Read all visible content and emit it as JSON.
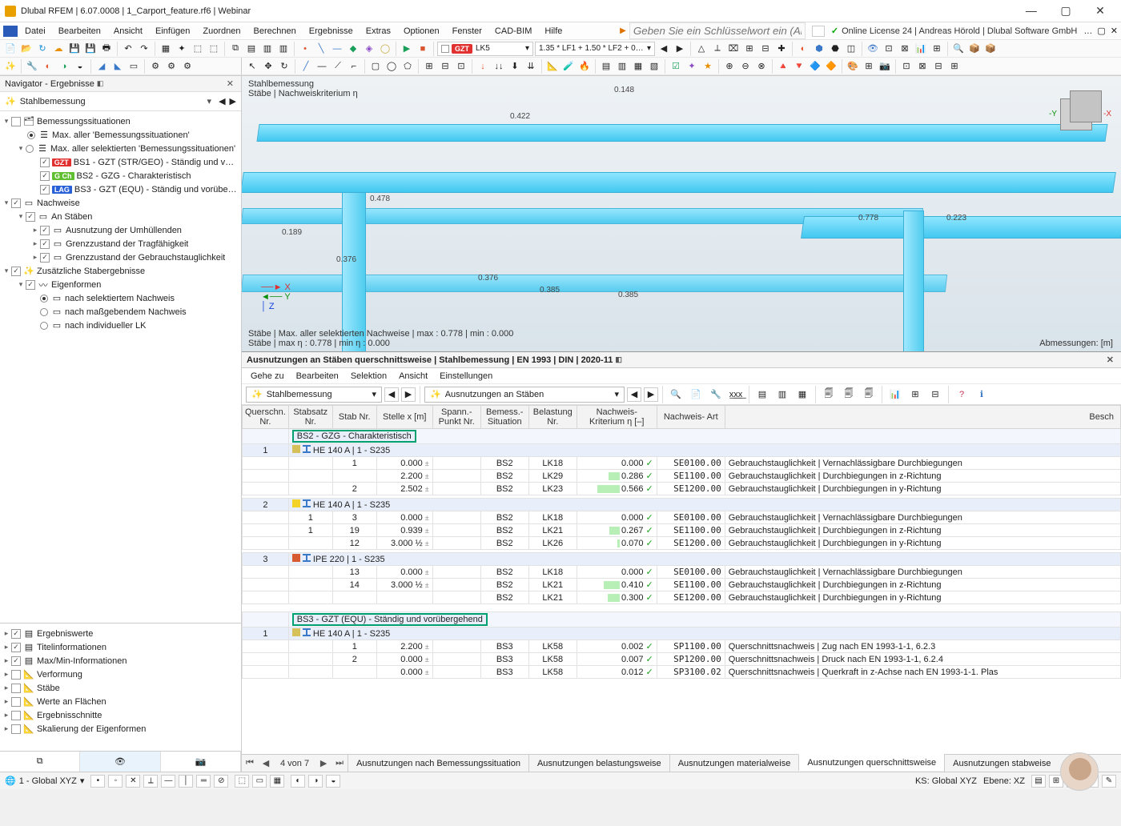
{
  "title": "Dlubal RFEM | 6.07.0008 | 1_Carport_feature.rf6 | Webinar",
  "menu": [
    "Datei",
    "Bearbeiten",
    "Ansicht",
    "Einfügen",
    "Zuordnen",
    "Berechnen",
    "Ergebnisse",
    "Extras",
    "Optionen",
    "Fenster",
    "CAD-BIM",
    "Hilfe"
  ],
  "searchPlaceholder": "Geben Sie ein Schlüsselwort ein (Alt…",
  "license": "Online License 24 | Andreas Hörold | Dlubal Software GmbH",
  "lcDrop": {
    "badge": "GZT",
    "lk": "LK5",
    "combo": "1.35 * LF1 + 1.50 * LF2 + 0…"
  },
  "navigator": {
    "title": "Navigator - Ergebnisse",
    "selector": "Stahlbemessung",
    "tree": {
      "bs": {
        "label": "Bemessungssituationen",
        "maxAll": "Max. aller 'Bemessungssituationen'",
        "maxSel": "Max. aller selektierten 'Bemessungssituationen'",
        "bs1": "BS1 - GZT (STR/GEO) - Ständig und vor…",
        "bs2": "BS2 - GZG - Charakteristisch",
        "bs3": "BS3 - GZT (EQU) - Ständig und vorüber…"
      },
      "nachweise": {
        "label": "Nachweise",
        "anStaeben": "An Stäben",
        "umh": "Ausnutzung der Umhüllenden",
        "trag": "Grenzzustand der Tragfähigkeit",
        "gebrauch": "Grenzzustand der Gebrauchstauglichkeit"
      },
      "zusatz": {
        "label": "Zusätzliche Stabergebnisse",
        "eig": "Eigenformen",
        "r1": "nach selektiertem Nachweis",
        "r2": "nach maßgebendem Nachweis",
        "r3": "nach individueller LK"
      }
    },
    "bottomNodes": [
      "Ergebniswerte",
      "Titelinformationen",
      "Max/Min-Informationen",
      "Verformung",
      "Stäbe",
      "Werte an Flächen",
      "Ergebnisschnitte",
      "Skalierung der Eigenformen"
    ]
  },
  "viewport": {
    "line1": "Stahlbemessung",
    "line2": "Stäbe | Nachweiskriterium η",
    "statsLine": "Stäbe | Max. aller selektierten Nachweise | max  : 0.778 | min  : 0.000",
    "etaLine": "Stäbe | max η : 0.778 | min η : 0.000",
    "dimLabel": "Abmessungen: [m]",
    "nums": {
      "a": "0.148",
      "b": "0.422",
      "c": "0.478",
      "d": "0.189",
      "e": "0.376",
      "f": "0.376",
      "g": "0.385",
      "h": "0.385",
      "i": "0.778",
      "j": "0.223"
    }
  },
  "results": {
    "title": "Ausnutzungen an Stäben querschnittsweise | Stahlbemessung | EN 1993 | DIN | 2020-11",
    "menus": [
      "Gehe zu",
      "Bearbeiten",
      "Selektion",
      "Ansicht",
      "Einstellungen"
    ],
    "leftSelector": "Stahlbemessung",
    "rightSelector": "Ausnutzungen an Stäben",
    "headers": {
      "q": "Querschn.\nNr.",
      "ss": "Stabsatz\nNr.",
      "st": "Stab\nNr.",
      "x": "Stelle\nx [m]",
      "sp": "Spann.-\nPunkt Nr.",
      "bs": "Bemess.-\nSituation",
      "lk": "Belastung\nNr.",
      "ratio": "Nachweis-\nKriterium η [–]",
      "art": "Nachweis-\nArt",
      "beschr": "Besch"
    },
    "group1": "BS2 - GZG - Charakteristisch",
    "group2": "BS3 - GZT (EQU) - Ständig und vorübergehend",
    "sections": [
      {
        "qnr": "1",
        "label": "HE 140 A | 1 - S235",
        "color": "#d6c05a",
        "rows": [
          {
            "ss": "",
            "st": "1",
            "x": "0.000",
            "sp": "",
            "bs": "BS2",
            "lk": "LK18",
            "ratio": "0.000",
            "ratiobar": 0,
            "art": "SE0100.00",
            "desc": "Gebrauchstauglichkeit | Vernachlässigbare Durchbiegungen"
          },
          {
            "ss": "",
            "st": "",
            "x": "2.200",
            "sp": "",
            "bs": "BS2",
            "lk": "LK29",
            "ratio": "0.286",
            "ratiobar": 14,
            "art": "SE1100.00",
            "desc": "Gebrauchstauglichkeit | Durchbiegungen in z-Richtung"
          },
          {
            "ss": "",
            "st": "2",
            "x": "2.502",
            "sp": "",
            "bs": "BS2",
            "lk": "LK23",
            "ratio": "0.566",
            "ratiobar": 28,
            "art": "SE1200.00",
            "desc": "Gebrauchstauglichkeit | Durchbiegungen in y-Richtung"
          }
        ]
      },
      {
        "qnr": "2",
        "label": "HE 140 A | 1 - S235",
        "color": "#f2d326",
        "rows": [
          {
            "ss": "1",
            "st": "3",
            "x": "0.000",
            "sp": "",
            "bs": "BS2",
            "lk": "LK18",
            "ratio": "0.000",
            "ratiobar": 0,
            "art": "SE0100.00",
            "desc": "Gebrauchstauglichkeit | Vernachlässigbare Durchbiegungen"
          },
          {
            "ss": "1",
            "st": "19",
            "x": "0.939",
            "sp": "",
            "bs": "BS2",
            "lk": "LK21",
            "ratio": "0.267",
            "ratiobar": 13,
            "art": "SE1100.00",
            "desc": "Gebrauchstauglichkeit | Durchbiegungen in z-Richtung"
          },
          {
            "ss": "",
            "st": "12",
            "x": "3.000 ½",
            "sp": "",
            "bs": "BS2",
            "lk": "LK26",
            "ratio": "0.070",
            "ratiobar": 3,
            "art": "SE1200.00",
            "desc": "Gebrauchstauglichkeit | Durchbiegungen in y-Richtung"
          }
        ]
      },
      {
        "qnr": "3",
        "label": "IPE 220 | 1 - S235",
        "color": "#d85a30",
        "rows": [
          {
            "ss": "",
            "st": "13",
            "x": "0.000",
            "sp": "",
            "bs": "BS2",
            "lk": "LK18",
            "ratio": "0.000",
            "ratiobar": 0,
            "art": "SE0100.00",
            "desc": "Gebrauchstauglichkeit | Vernachlässigbare Durchbiegungen"
          },
          {
            "ss": "",
            "st": "14",
            "x": "3.000 ½",
            "sp": "",
            "bs": "BS2",
            "lk": "LK21",
            "ratio": "0.410",
            "ratiobar": 20,
            "art": "SE1100.00",
            "desc": "Gebrauchstauglichkeit | Durchbiegungen in z-Richtung"
          },
          {
            "ss": "",
            "st": "",
            "x": "",
            "sp": "",
            "bs": "BS2",
            "lk": "LK21",
            "ratio": "0.300",
            "ratiobar": 15,
            "art": "SE1200.00",
            "desc": "Gebrauchstauglichkeit | Durchbiegungen in y-Richtung"
          }
        ]
      },
      {
        "qnr": "1",
        "label": "HE 140 A | 1 - S235",
        "color": "#d6c05a",
        "group2": true,
        "rows": [
          {
            "ss": "",
            "st": "1",
            "x": "2.200",
            "sp": "",
            "bs": "BS3",
            "lk": "LK58",
            "ratio": "0.002",
            "ratiobar": 0,
            "art": "SP1100.00",
            "desc": "Querschnittsnachweis | Zug nach EN 1993-1-1, 6.2.3"
          },
          {
            "ss": "",
            "st": "2",
            "x": "0.000",
            "sp": "",
            "bs": "BS3",
            "lk": "LK58",
            "ratio": "0.007",
            "ratiobar": 0,
            "art": "SP1200.00",
            "desc": "Querschnittsnachweis | Druck nach EN 1993-1-1, 6.2.4"
          },
          {
            "ss": "",
            "st": "",
            "x": "0.000",
            "sp": "",
            "bs": "BS3",
            "lk": "LK58",
            "ratio": "0.012",
            "ratiobar": 0,
            "art": "SP3100.02",
            "desc": "Querschnittsnachweis | Querkraft in z-Achse nach EN 1993-1-1.        Plas"
          }
        ]
      }
    ],
    "page": "4 von 7",
    "tabs": [
      "Ausnutzungen nach Bemessungssituation",
      "Ausnutzungen belastungsweise",
      "Ausnutzungen materialweise",
      "Ausnutzungen querschnittsweise",
      "Ausnutzungen stabweise"
    ]
  },
  "status": {
    "coord": "1 - Global XYZ",
    "ks": "KS: Global XYZ",
    "ebene": "Ebene: XZ"
  }
}
